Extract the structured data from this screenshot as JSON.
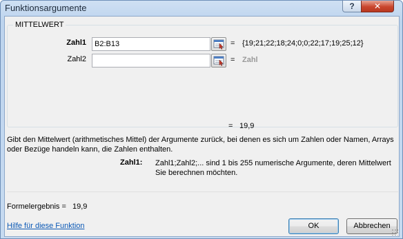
{
  "window": {
    "title": "Funktionsargumente",
    "help_label": "?",
    "close_label": "✕"
  },
  "function": {
    "name": "MITTELWERT",
    "args": [
      {
        "label": "Zahl1",
        "input": "B2:B13",
        "result": "{19;21;22;18;24;0;0;22;17;19;25;12}"
      },
      {
        "label": "Zahl2",
        "input": "",
        "result": "Zahl"
      }
    ],
    "result_eq": "=",
    "result_value": "19,9",
    "description": "Gibt den Mittelwert (arithmetisches Mittel) der Argumente zurück, bei denen es sich um Zahlen oder Namen, Arrays oder Bezüge handeln kann, die Zahlen enthalten.",
    "param_name": "Zahl1:",
    "param_description": "Zahl1;Zahl2;... sind 1 bis 255 numerische Argumente, deren Mittelwert Sie berechnen möchten."
  },
  "footer": {
    "formula_result_label": "Formelergebnis =",
    "formula_result_value": "19,9",
    "help_link": "Hilfe für diese Funktion",
    "ok_label": "OK",
    "cancel_label": "Abbrechen"
  },
  "icons": {
    "help": "help-icon",
    "close": "close-icon",
    "collapse": "collapse-dialog-icon"
  },
  "colors": {
    "title_bar": "#c7dbf1",
    "close_button": "#c9462e",
    "link": "#0a58b5"
  }
}
